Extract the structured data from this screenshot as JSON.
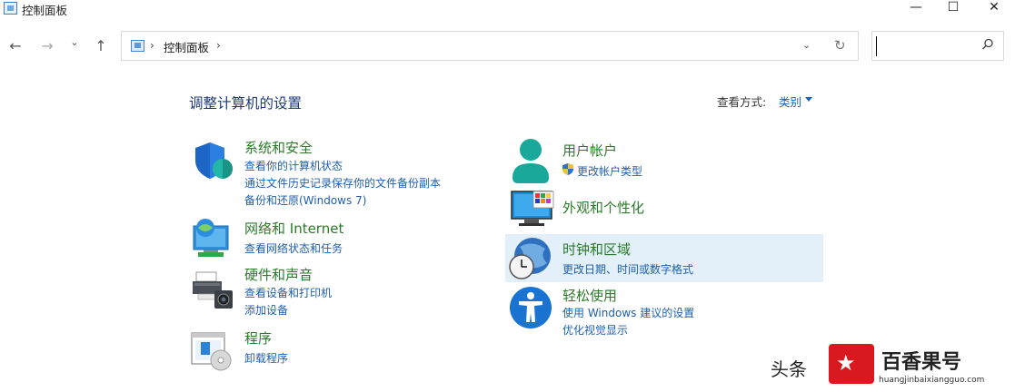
{
  "window": {
    "title": "控制面板",
    "minimize": "—",
    "maximize": "☐",
    "close": "✕"
  },
  "nav": {
    "back": "←",
    "forward": "→",
    "recent": "⌄",
    "up": "↑"
  },
  "address": {
    "crumb": "控制面板",
    "sep": "›",
    "sep2": "›",
    "dropdown": "⌄",
    "refresh": "↻"
  },
  "search": {
    "value": "",
    "placeholder": ""
  },
  "heading": "调整计算机的设置",
  "view": {
    "label": "查看方式:",
    "value": "类别"
  },
  "left_categories": [
    {
      "title": "系统和安全",
      "links": [
        "查看你的计算机状态",
        "通过文件历史记录保存你的文件备份副本",
        "备份和还原(Windows 7)"
      ]
    },
    {
      "title": "网络和 Internet",
      "links": [
        "查看网络状态和任务"
      ]
    },
    {
      "title": "硬件和声音",
      "links": [
        "查看设备和打印机",
        "添加设备"
      ]
    },
    {
      "title": "程序",
      "links": [
        "卸载程序"
      ]
    }
  ],
  "right_categories": [
    {
      "title": "用户帐户",
      "links": [
        "更改帐户类型"
      ]
    },
    {
      "title": "外观和个性化",
      "links": []
    },
    {
      "title": "时钟和区域",
      "links": [
        "更改日期、时间或数字格式"
      ]
    },
    {
      "title": "轻松使用",
      "links": [
        "使用 Windows 建议的设置",
        "优化视觉显示"
      ]
    }
  ],
  "watermark": {
    "prefix": "头条",
    "brand": "百香果号",
    "url": "huangjinbaixiangguo.com"
  },
  "colors": {
    "category_title": "#2a7a2a",
    "link": "#1f5fad",
    "heading": "#1c3a78",
    "hover": "#e3eff9"
  }
}
